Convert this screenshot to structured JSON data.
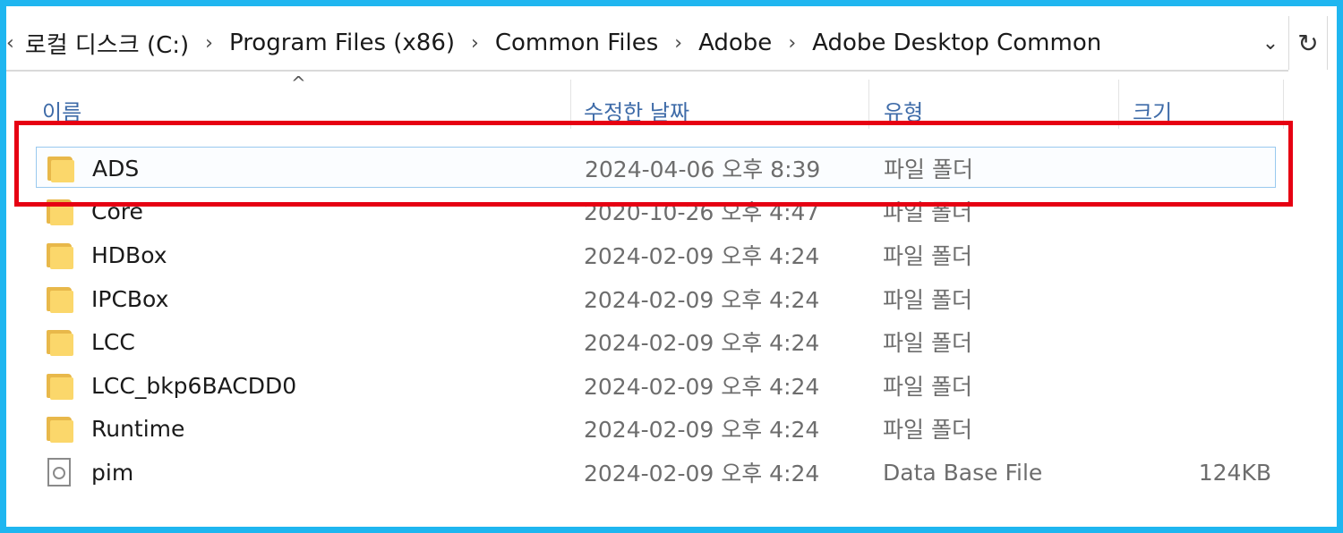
{
  "address": {
    "crumbs": [
      "로컬 디스크 (C:)",
      "Program Files (x86)",
      "Common Files",
      "Adobe",
      "Adobe Desktop Common"
    ],
    "first_chevron": "‹",
    "separator": "›",
    "dropdown_glyph": "⌄",
    "refresh_glyph": "↻"
  },
  "columns": {
    "name": "이름",
    "date": "수정한 날짜",
    "type": "유형",
    "size": "크기",
    "sort_glyph": "^"
  },
  "rows": [
    {
      "name": "ADS",
      "date": "2024-04-06 오후 8:39",
      "type": "파일 폴더",
      "size": "",
      "icon": "folder-icon",
      "selected": true
    },
    {
      "name": "Core",
      "date": "2020-10-26 오후 4:47",
      "type": "파일 폴더",
      "size": "",
      "icon": "folder-icon"
    },
    {
      "name": "HDBox",
      "date": "2024-02-09 오후 4:24",
      "type": "파일 폴더",
      "size": "",
      "icon": "folder-icon"
    },
    {
      "name": "IPCBox",
      "date": "2024-02-09 오후 4:24",
      "type": "파일 폴더",
      "size": "",
      "icon": "folder-icon"
    },
    {
      "name": "LCC",
      "date": "2024-02-09 오후 4:24",
      "type": "파일 폴더",
      "size": "",
      "icon": "folder-icon"
    },
    {
      "name": "LCC_bkp6BACDD0",
      "date": "2024-02-09 오후 4:24",
      "type": "파일 폴더",
      "size": "",
      "icon": "folder-icon"
    },
    {
      "name": "Runtime",
      "date": "2024-02-09 오후 4:24",
      "type": "파일 폴더",
      "size": "",
      "icon": "folder-icon"
    },
    {
      "name": "pim",
      "date": "2024-02-09 오후 4:24",
      "type": "Data Base File",
      "size": "124KB",
      "icon": "database-file-icon"
    }
  ],
  "colors": {
    "frame": "#1fb6f0",
    "highlight": "#e60012",
    "header_text": "#3e6ba8",
    "folder": "#fbd76b"
  }
}
